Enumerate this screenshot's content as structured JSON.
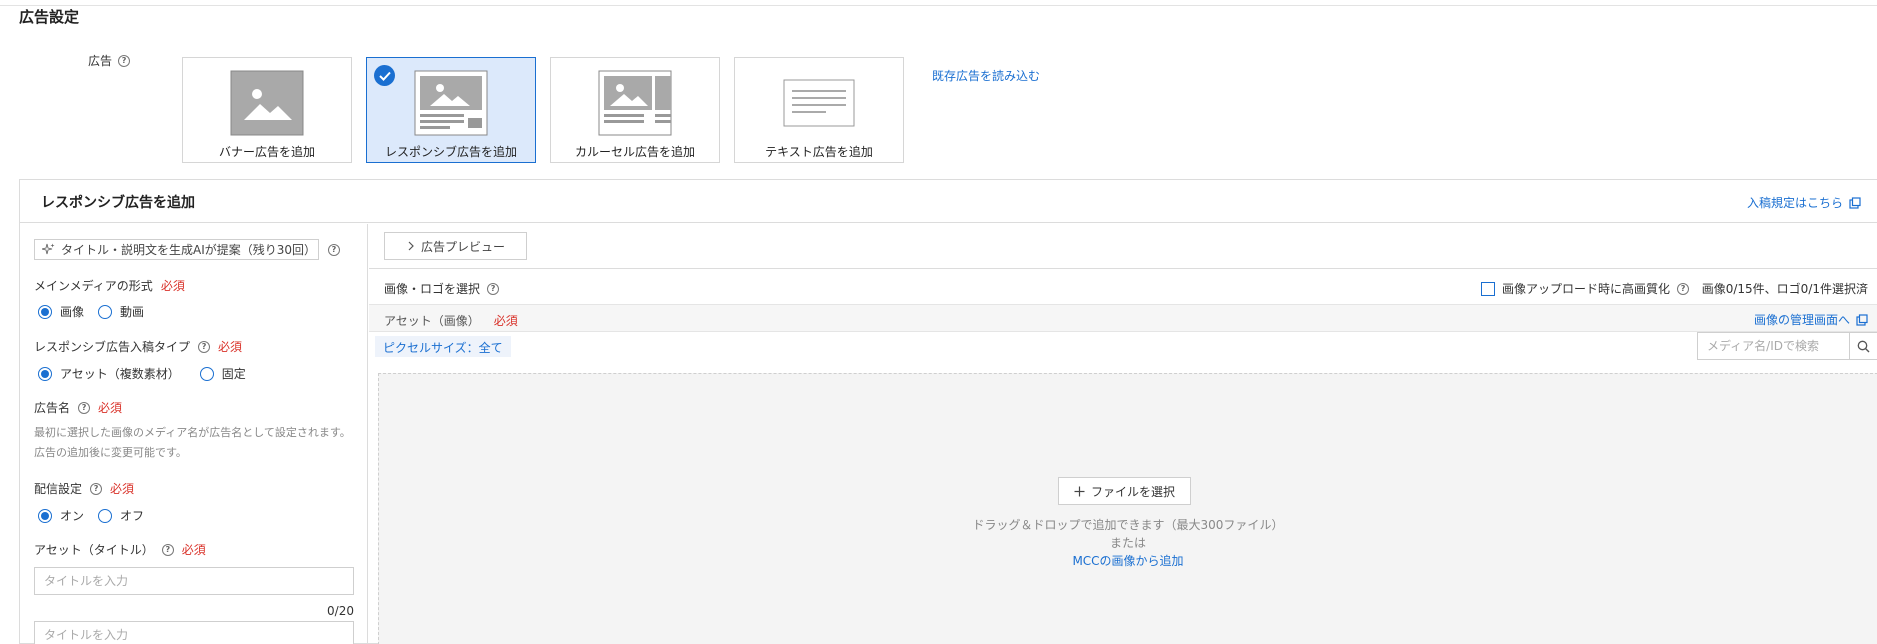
{
  "page": {
    "title": "広告設定"
  },
  "ad_section": {
    "label": "広告",
    "types": [
      {
        "label": "バナー広告を追加",
        "selected": false,
        "thumb": "banner-thumb-icon"
      },
      {
        "label": "レスポンシブ広告を追加",
        "selected": true,
        "thumb": "responsive-thumb-icon"
      },
      {
        "label": "カルーセル広告を追加",
        "selected": false,
        "thumb": "carousel-thumb-icon"
      },
      {
        "label": "テキスト広告を追加",
        "selected": false,
        "thumb": "text-thumb-icon"
      }
    ],
    "load_existing": "既存広告を読み込む"
  },
  "panel": {
    "title": "レスポンシブ広告を追加",
    "guideline_link": "入稿規定はこちら",
    "left": {
      "ai_button": "タイトル・説明文を生成AIが提案（残り30回）",
      "main_media": {
        "label": "メインメディアの形式",
        "required": "必須",
        "options": [
          "画像",
          "動画"
        ],
        "selected": "画像"
      },
      "input_type": {
        "label": "レスポンシブ広告入稿タイプ",
        "required": "必須",
        "options": [
          "アセット（複数素材）",
          "固定"
        ],
        "selected": "アセット（複数素材）"
      },
      "ad_name": {
        "label": "広告名",
        "required": "必須",
        "note_line1": "最初に選択した画像のメディア名が広告名として設定されます。",
        "note_line2": "広告の追加後に変更可能です。"
      },
      "delivery": {
        "label": "配信設定",
        "required": "必須",
        "options": [
          "オン",
          "オフ"
        ],
        "selected": "オン"
      },
      "asset_title": {
        "label": "アセット（タイトル）",
        "required": "必須",
        "placeholder": "タイトルを入力",
        "counter": "0/20",
        "placeholder2": "タイトルを入力"
      }
    },
    "right": {
      "preview_button": "広告プレビュー",
      "select_label": "画像・ロゴを選択",
      "hq_upload_label": "画像アップロード時に高画質化",
      "count_text": "画像0/15件、ロゴ0/1件選択済",
      "asset_label": "アセット（画像）",
      "asset_required": "必須",
      "manage_link": "画像の管理画面へ",
      "pixel_chip": "ピクセルサイズ：全て",
      "search_placeholder": "メディア名/IDで検索",
      "file_button": "ファイルを選択",
      "drop_text": "ドラッグ＆ドロップで追加できます（最大300ファイル）",
      "or_text": "または",
      "mcc_link": "MCCの画像から追加"
    }
  },
  "colors": {
    "accent": "#1a6fd1",
    "required": "#d9322a",
    "selected_bg": "#dce9fb"
  }
}
